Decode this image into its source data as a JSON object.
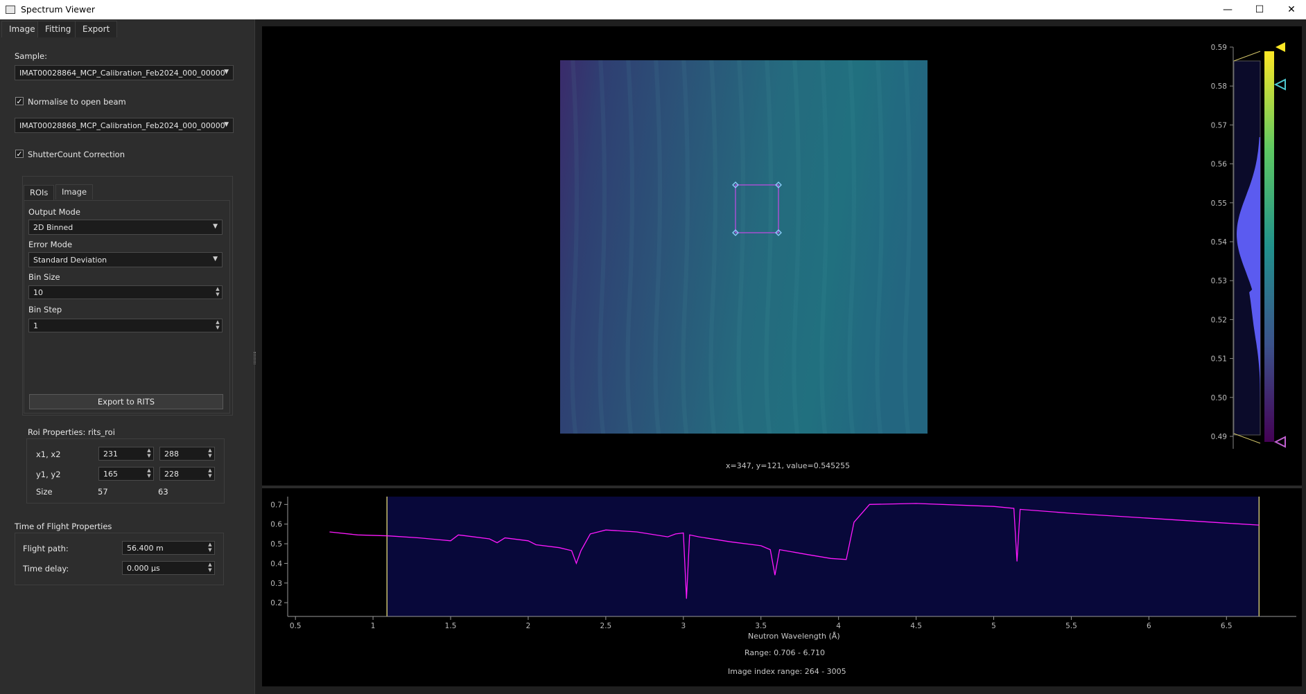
{
  "window": {
    "title": "Spectrum Viewer",
    "controls": {
      "minimize": "—",
      "maximize": "☐",
      "close": "✕"
    }
  },
  "main_tabs": [
    "Image",
    "Fitting",
    "Export"
  ],
  "sample": {
    "label": "Sample:",
    "value": "IMAT00028864_MCP_Calibration_Feb2024_000_00000"
  },
  "normalise": {
    "label": "Normalise to open beam",
    "checked": true,
    "value": "IMAT00028868_MCP_Calibration_Feb2024_000_00000"
  },
  "shutter": {
    "label": "ShutterCount Correction",
    "checked": true
  },
  "sub_tabs": [
    "ROIs",
    "Image"
  ],
  "output_mode": {
    "label": "Output Mode",
    "value": "2D Binned"
  },
  "error_mode": {
    "label": "Error Mode",
    "value": "Standard Deviation"
  },
  "bin_size": {
    "label": "Bin Size",
    "value": "10"
  },
  "bin_step": {
    "label": "Bin Step",
    "value": "1"
  },
  "export_button": "Export to RITS",
  "roi_props": {
    "title": "Roi Properties: rits_roi",
    "x_label": "x1, x2",
    "x1": "231",
    "x2": "288",
    "y_label": "y1, y2",
    "y1": "165",
    "y2": "228",
    "size_label": "Size",
    "size_w": "57",
    "size_h": "63"
  },
  "tof": {
    "title": "Time of Flight Properties",
    "flight_label": "Flight path:",
    "flight_value": "56.400 m",
    "delay_label": "Time delay:",
    "delay_value": "0.000 µs"
  },
  "viewer": {
    "cursor_readout": "x=347, y=121, value=0.545255",
    "colorbar_ticks": [
      "0.59",
      "0.58",
      "0.57",
      "0.56",
      "0.55",
      "0.54",
      "0.53",
      "0.52",
      "0.51",
      "0.50",
      "0.49"
    ],
    "colors": {
      "low": "#440154",
      "mid": "#21918c",
      "high": "#fde725",
      "roi": "#b04fd8"
    }
  },
  "spectrum": {
    "xlabel": "Neutron Wavelength (Å)",
    "range_text": "Range: 0.706 - 6.710",
    "index_text": "Image index range: 264 - 3005"
  },
  "chart_data": {
    "type": "line",
    "xlabel": "Neutron Wavelength (Å)",
    "ylabel": "",
    "xlim": [
      0.45,
      6.95
    ],
    "ylim": [
      0.13,
      0.74
    ],
    "xticks": [
      0.5,
      1,
      1.5,
      2,
      2.5,
      3,
      3.5,
      4,
      4.5,
      5,
      5.5,
      6,
      6.5
    ],
    "yticks": [
      0.2,
      0.3,
      0.4,
      0.5,
      0.6,
      0.7
    ],
    "selected_range": [
      1.09,
      6.71
    ],
    "line_color": "#ff19ff",
    "series": [
      {
        "x": [
          0.72,
          0.9,
          1.1,
          1.3,
          1.5,
          1.55,
          1.6,
          1.75,
          1.8,
          1.85,
          2.0,
          2.05,
          2.2,
          2.28,
          2.31,
          2.34,
          2.4,
          2.5,
          2.7,
          2.9,
          2.95,
          3.0,
          3.02,
          3.04,
          3.1,
          3.3,
          3.5,
          3.56,
          3.59,
          3.62,
          3.8,
          3.95,
          4.05,
          4.1,
          4.2,
          4.5,
          5.0,
          5.13,
          5.15,
          5.17,
          5.5,
          6.0,
          6.5,
          6.71
        ],
        "y": [
          0.56,
          0.545,
          0.54,
          0.53,
          0.515,
          0.545,
          0.54,
          0.525,
          0.505,
          0.53,
          0.515,
          0.495,
          0.48,
          0.465,
          0.4,
          0.465,
          0.55,
          0.57,
          0.56,
          0.535,
          0.55,
          0.555,
          0.22,
          0.545,
          0.535,
          0.51,
          0.49,
          0.47,
          0.34,
          0.47,
          0.445,
          0.425,
          0.42,
          0.61,
          0.7,
          0.705,
          0.69,
          0.68,
          0.41,
          0.675,
          0.655,
          0.63,
          0.605,
          0.595
        ]
      }
    ]
  }
}
